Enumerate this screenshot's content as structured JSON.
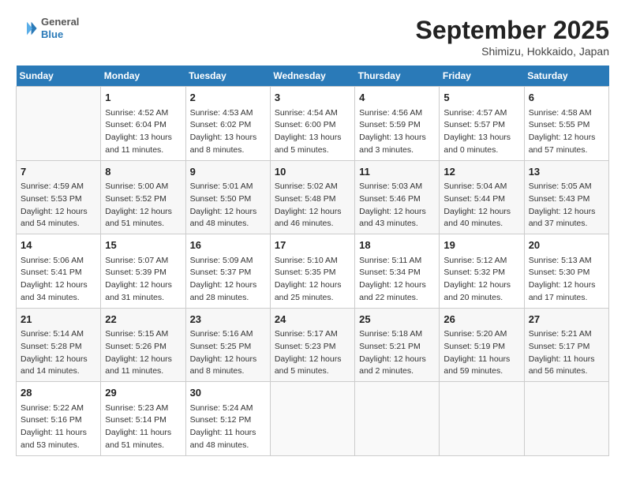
{
  "header": {
    "logo_line1": "General",
    "logo_line2": "Blue",
    "month_year": "September 2025",
    "location": "Shimizu, Hokkaido, Japan"
  },
  "days_of_week": [
    "Sunday",
    "Monday",
    "Tuesday",
    "Wednesday",
    "Thursday",
    "Friday",
    "Saturday"
  ],
  "weeks": [
    [
      {
        "day": "",
        "info": ""
      },
      {
        "day": "1",
        "info": "Sunrise: 4:52 AM\nSunset: 6:04 PM\nDaylight: 13 hours\nand 11 minutes."
      },
      {
        "day": "2",
        "info": "Sunrise: 4:53 AM\nSunset: 6:02 PM\nDaylight: 13 hours\nand 8 minutes."
      },
      {
        "day": "3",
        "info": "Sunrise: 4:54 AM\nSunset: 6:00 PM\nDaylight: 13 hours\nand 5 minutes."
      },
      {
        "day": "4",
        "info": "Sunrise: 4:56 AM\nSunset: 5:59 PM\nDaylight: 13 hours\nand 3 minutes."
      },
      {
        "day": "5",
        "info": "Sunrise: 4:57 AM\nSunset: 5:57 PM\nDaylight: 13 hours\nand 0 minutes."
      },
      {
        "day": "6",
        "info": "Sunrise: 4:58 AM\nSunset: 5:55 PM\nDaylight: 12 hours\nand 57 minutes."
      }
    ],
    [
      {
        "day": "7",
        "info": "Sunrise: 4:59 AM\nSunset: 5:53 PM\nDaylight: 12 hours\nand 54 minutes."
      },
      {
        "day": "8",
        "info": "Sunrise: 5:00 AM\nSunset: 5:52 PM\nDaylight: 12 hours\nand 51 minutes."
      },
      {
        "day": "9",
        "info": "Sunrise: 5:01 AM\nSunset: 5:50 PM\nDaylight: 12 hours\nand 48 minutes."
      },
      {
        "day": "10",
        "info": "Sunrise: 5:02 AM\nSunset: 5:48 PM\nDaylight: 12 hours\nand 46 minutes."
      },
      {
        "day": "11",
        "info": "Sunrise: 5:03 AM\nSunset: 5:46 PM\nDaylight: 12 hours\nand 43 minutes."
      },
      {
        "day": "12",
        "info": "Sunrise: 5:04 AM\nSunset: 5:44 PM\nDaylight: 12 hours\nand 40 minutes."
      },
      {
        "day": "13",
        "info": "Sunrise: 5:05 AM\nSunset: 5:43 PM\nDaylight: 12 hours\nand 37 minutes."
      }
    ],
    [
      {
        "day": "14",
        "info": "Sunrise: 5:06 AM\nSunset: 5:41 PM\nDaylight: 12 hours\nand 34 minutes."
      },
      {
        "day": "15",
        "info": "Sunrise: 5:07 AM\nSunset: 5:39 PM\nDaylight: 12 hours\nand 31 minutes."
      },
      {
        "day": "16",
        "info": "Sunrise: 5:09 AM\nSunset: 5:37 PM\nDaylight: 12 hours\nand 28 minutes."
      },
      {
        "day": "17",
        "info": "Sunrise: 5:10 AM\nSunset: 5:35 PM\nDaylight: 12 hours\nand 25 minutes."
      },
      {
        "day": "18",
        "info": "Sunrise: 5:11 AM\nSunset: 5:34 PM\nDaylight: 12 hours\nand 22 minutes."
      },
      {
        "day": "19",
        "info": "Sunrise: 5:12 AM\nSunset: 5:32 PM\nDaylight: 12 hours\nand 20 minutes."
      },
      {
        "day": "20",
        "info": "Sunrise: 5:13 AM\nSunset: 5:30 PM\nDaylight: 12 hours\nand 17 minutes."
      }
    ],
    [
      {
        "day": "21",
        "info": "Sunrise: 5:14 AM\nSunset: 5:28 PM\nDaylight: 12 hours\nand 14 minutes."
      },
      {
        "day": "22",
        "info": "Sunrise: 5:15 AM\nSunset: 5:26 PM\nDaylight: 12 hours\nand 11 minutes."
      },
      {
        "day": "23",
        "info": "Sunrise: 5:16 AM\nSunset: 5:25 PM\nDaylight: 12 hours\nand 8 minutes."
      },
      {
        "day": "24",
        "info": "Sunrise: 5:17 AM\nSunset: 5:23 PM\nDaylight: 12 hours\nand 5 minutes."
      },
      {
        "day": "25",
        "info": "Sunrise: 5:18 AM\nSunset: 5:21 PM\nDaylight: 12 hours\nand 2 minutes."
      },
      {
        "day": "26",
        "info": "Sunrise: 5:20 AM\nSunset: 5:19 PM\nDaylight: 11 hours\nand 59 minutes."
      },
      {
        "day": "27",
        "info": "Sunrise: 5:21 AM\nSunset: 5:17 PM\nDaylight: 11 hours\nand 56 minutes."
      }
    ],
    [
      {
        "day": "28",
        "info": "Sunrise: 5:22 AM\nSunset: 5:16 PM\nDaylight: 11 hours\nand 53 minutes."
      },
      {
        "day": "29",
        "info": "Sunrise: 5:23 AM\nSunset: 5:14 PM\nDaylight: 11 hours\nand 51 minutes."
      },
      {
        "day": "30",
        "info": "Sunrise: 5:24 AM\nSunset: 5:12 PM\nDaylight: 11 hours\nand 48 minutes."
      },
      {
        "day": "",
        "info": ""
      },
      {
        "day": "",
        "info": ""
      },
      {
        "day": "",
        "info": ""
      },
      {
        "day": "",
        "info": ""
      }
    ]
  ]
}
